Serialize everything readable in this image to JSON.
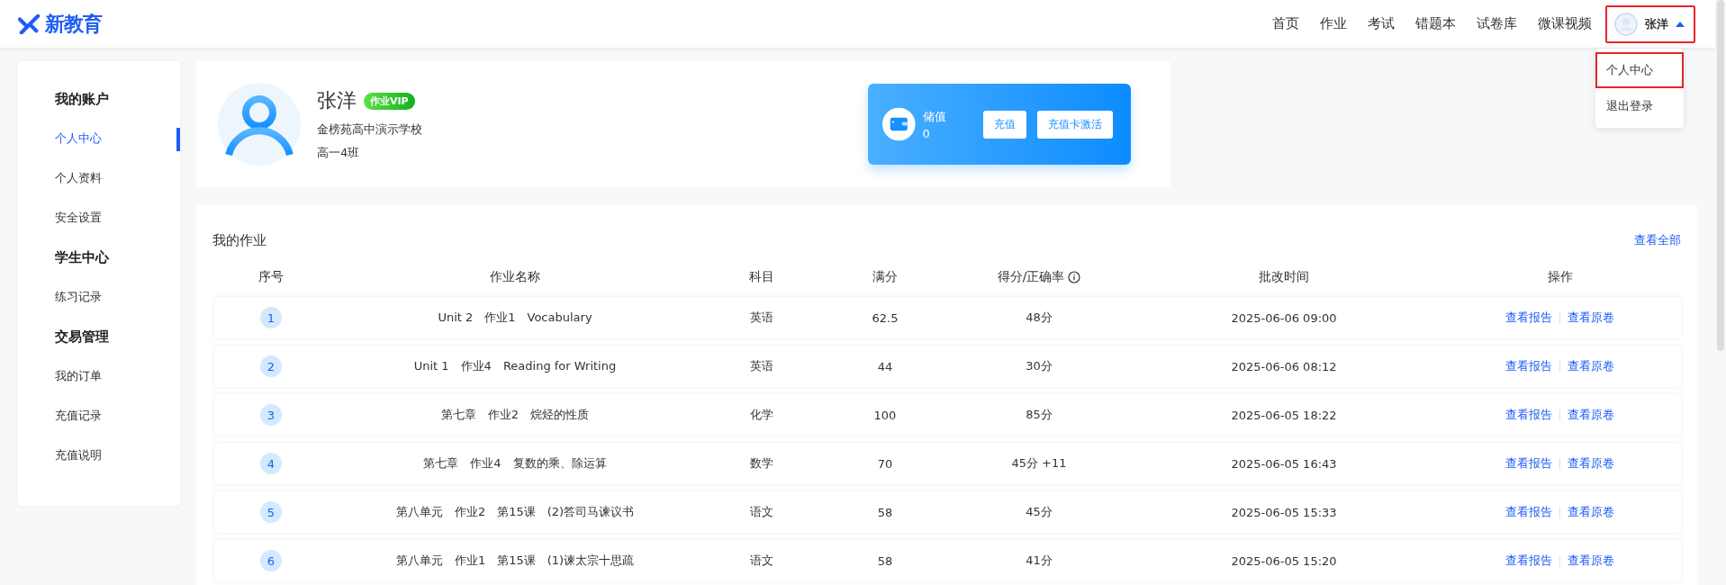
{
  "header": {
    "logo": "新教育",
    "nav": [
      {
        "label": "首页",
        "selected": false
      },
      {
        "label": "作业",
        "selected": false
      },
      {
        "label": "考试",
        "selected": false
      },
      {
        "label": "错题本",
        "selected": false
      },
      {
        "label": "试卷库",
        "selected": false
      },
      {
        "label": "微课视频",
        "selected": false
      }
    ],
    "user": {
      "name": "张洋",
      "expanded": true,
      "highlighted": true
    }
  },
  "user_menu": [
    {
      "label": "个人中心",
      "highlighted": true
    },
    {
      "label": "退出登录",
      "highlighted": false
    }
  ],
  "sidebar": [
    {
      "title": "我的账户",
      "items": [
        {
          "label": "个人中心",
          "selected": true
        },
        {
          "label": "个人资料",
          "selected": false
        },
        {
          "label": "安全设置",
          "selected": false
        }
      ]
    },
    {
      "title": "学生中心",
      "items": [
        {
          "label": "练习记录",
          "selected": false
        }
      ]
    },
    {
      "title": "交易管理",
      "items": [
        {
          "label": "我的订单",
          "selected": false
        },
        {
          "label": "充值记录",
          "selected": false
        },
        {
          "label": "充值说明",
          "selected": false
        }
      ]
    }
  ],
  "profile": {
    "name": "张洋",
    "badge": "作业VIP",
    "school": "金榜苑高中演示学校",
    "class": "高一4班"
  },
  "wallet": {
    "label": "储值",
    "value": "0",
    "buttons": [
      "充值",
      "充值卡激活"
    ]
  },
  "homework": {
    "title": "我的作业",
    "view_all": "查看全部",
    "columns": [
      {
        "label": "序号",
        "info": false
      },
      {
        "label": "作业名称",
        "info": false
      },
      {
        "label": "科目",
        "info": false
      },
      {
        "label": "满分",
        "info": false
      },
      {
        "label": "得分/正确率",
        "info": true
      },
      {
        "label": "批改时间",
        "info": false
      },
      {
        "label": "操作",
        "info": false
      }
    ],
    "rows": [
      {
        "index": "1",
        "name": "Unit 2　作业1　Vocabulary",
        "subject": "英语",
        "full_score": "62.5",
        "score": "48分",
        "time": "2025-06-06 09:00",
        "actions": [
          "查看报告",
          "查看原卷"
        ]
      },
      {
        "index": "2",
        "name": "Unit 1　作业4　Reading for Writing",
        "subject": "英语",
        "full_score": "44",
        "score": "30分",
        "time": "2025-06-06 08:12",
        "actions": [
          "查看报告",
          "查看原卷"
        ]
      },
      {
        "index": "3",
        "name": "第七章　作业2　烷烃的性质",
        "subject": "化学",
        "full_score": "100",
        "score": "85分",
        "time": "2025-06-05 18:22",
        "actions": [
          "查看报告",
          "查看原卷"
        ]
      },
      {
        "index": "4",
        "name": "第七章　作业4　复数的乘、除运算",
        "subject": "数学",
        "full_score": "70",
        "score": "45分 +11",
        "time": "2025-06-05 16:43",
        "actions": [
          "查看报告",
          "查看原卷"
        ]
      },
      {
        "index": "5",
        "name": "第八单元　作业2　第15课　(2)答司马谏议书",
        "subject": "语文",
        "full_score": "58",
        "score": "45分",
        "time": "2025-06-05 15:33",
        "actions": [
          "查看报告",
          "查看原卷"
        ]
      },
      {
        "index": "6",
        "name": "第八单元　作业1　第15课　(1)谏太宗十思疏",
        "subject": "语文",
        "full_score": "58",
        "score": "41分",
        "time": "2025-06-05 15:20",
        "actions": [
          "查看报告",
          "查看原卷"
        ]
      }
    ]
  }
}
